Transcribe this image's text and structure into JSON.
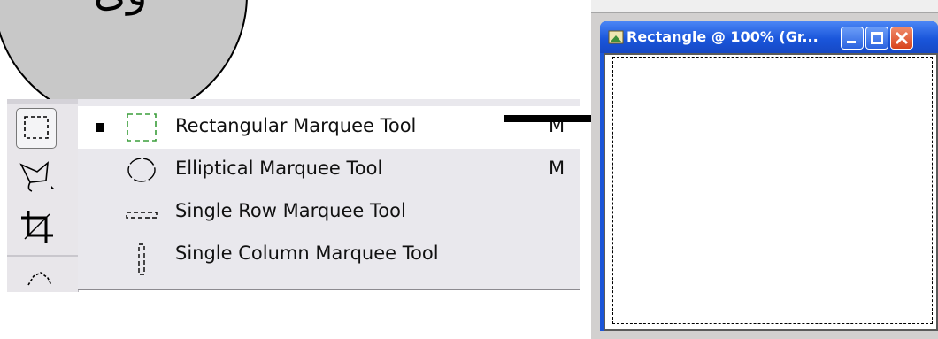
{
  "badge": {
    "text": "ﻭﻯ"
  },
  "menu": {
    "items": [
      {
        "label": "Rectangular Marquee Tool",
        "shortcut": "M",
        "selected": true,
        "icon": "rectangular-marquee-icon"
      },
      {
        "label": "Elliptical Marquee Tool",
        "shortcut": "M",
        "selected": false,
        "icon": "elliptical-marquee-icon"
      },
      {
        "label": "Single Row Marquee Tool",
        "shortcut": "",
        "selected": false,
        "icon": "single-row-marquee-icon"
      },
      {
        "label": "Single Column Marquee Tool",
        "shortcut": "",
        "selected": false,
        "icon": "single-column-marquee-icon"
      }
    ]
  },
  "toolbox": {
    "tools": [
      "marquee-tool-icon",
      "lasso-tool-icon",
      "crop-tool-icon",
      "magic-wand-tool-icon"
    ]
  },
  "document": {
    "title": "Rectangle @ 100% (Gr..."
  },
  "colors": {
    "titlebar": "#1a56db",
    "close_button": "#d8431b",
    "menu_background": "#e9e8ed"
  }
}
